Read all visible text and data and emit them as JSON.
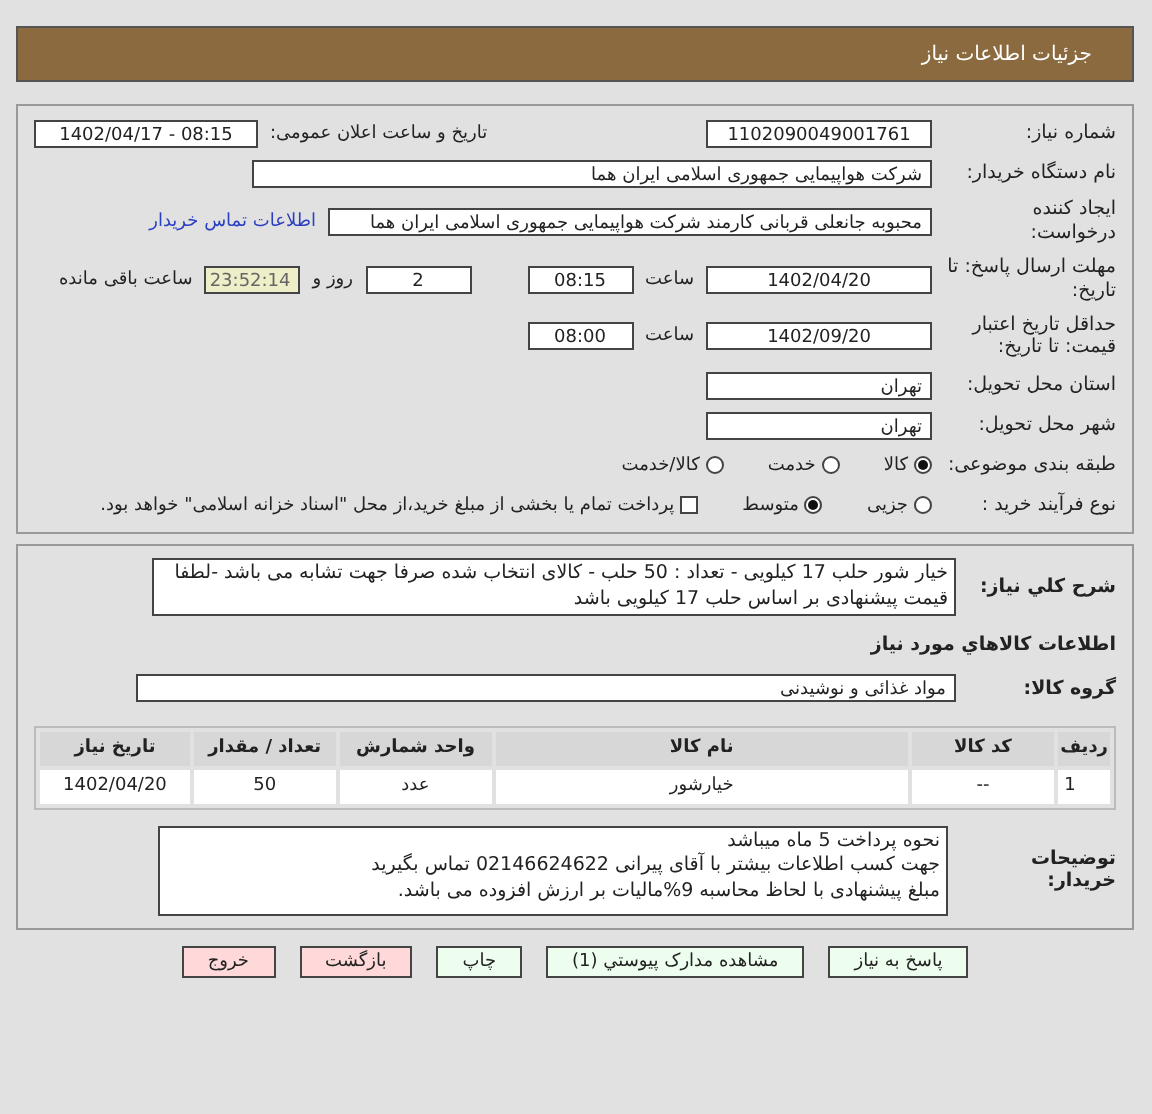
{
  "header": {
    "title": "جزئیات اطلاعات نیاز"
  },
  "need_number": {
    "label": "شماره نیاز:",
    "value": "1102090049001761"
  },
  "announce": {
    "label": "تاریخ و ساعت اعلان عمومی:",
    "value": "1402/04/17 - 08:15"
  },
  "buyer": {
    "label": "نام دستگاه خریدار:",
    "value": "شرکت هواپیمایی جمهوری اسلامی ایران هما"
  },
  "creator": {
    "label": "ایجاد کننده درخواست:",
    "value": "محبوبه جانعلی قربانی کارمند شرکت هواپیمایی جمهوری اسلامی ایران هما",
    "link": "اطلاعات تماس خریدار"
  },
  "deadline": {
    "label": "مهلت ارسال پاسخ: تا تاریخ:",
    "date": "1402/04/20",
    "time_label": "ساعت",
    "time": "08:15",
    "days": "2",
    "days_label": "روز و",
    "remaining": "23:52:14",
    "remaining_label": "ساعت باقی مانده"
  },
  "validity": {
    "label": "حداقل تاریخ اعتبار قیمت: تا تاریخ:",
    "date": "1402/09/20",
    "time_label": "ساعت",
    "time": "08:00"
  },
  "province": {
    "label": "استان محل تحویل:",
    "value": "تهران"
  },
  "city": {
    "label": "شهر محل تحویل:",
    "value": "تهران"
  },
  "category": {
    "label": "طبقه بندی موضوعی:",
    "options": [
      {
        "label": "کالا",
        "selected": true
      },
      {
        "label": "خدمت",
        "selected": false
      },
      {
        "label": "کالا/خدمت",
        "selected": false
      }
    ]
  },
  "process": {
    "label": "نوع فرآیند خرید :",
    "options": [
      {
        "label": "جزیی",
        "selected": false
      },
      {
        "label": "متوسط",
        "selected": true
      }
    ],
    "payment_checkbox": {
      "label": "پرداخت تمام یا بخشی از مبلغ خرید،از محل \"اسناد خزانه اسلامی\" خواهد بود.",
      "checked": false
    }
  },
  "description": {
    "label": "شرح کلي نياز:",
    "value": "خیار شور حلب 17 کیلویی - تعداد : 50 حلب - کالای انتخاب شده صرفا جهت تشابه می باشد -لطفا قیمت پیشنهادی بر اساس حلب 17 کیلویی باشد"
  },
  "goods_heading": "اطلاعات کالاهاي مورد نياز",
  "goods_group": {
    "label": "گروه کالا:",
    "value": "مواد غذائی و نوشیدنی"
  },
  "table": {
    "columns": [
      "ردیف",
      "کد کالا",
      "نام کالا",
      "واحد شمارش",
      "تعداد / مقدار",
      "تاریخ نیاز"
    ],
    "rows": [
      [
        "1",
        "--",
        "خیارشور",
        "عدد",
        "50",
        "1402/04/20"
      ]
    ]
  },
  "buyer_notes": {
    "label": "توضیحات خریدار:",
    "lines": [
      "نحوه پرداخت 5 ماه میباشد",
      "جهت کسب اطلاعات بیشتر با آقای پیرانی  02146624622 تماس بگیرید",
      "مبلغ پیشنهادی با لحاظ محاسبه 9%مالیات بر ارزش افزوده می باشد."
    ]
  },
  "buttons": [
    {
      "label": "پاسخ به نیاز",
      "color": "#eefeee"
    },
    {
      "label": "مشاهده مدارک پیوستي (1)",
      "color": "#eefeee"
    },
    {
      "label": "چاپ",
      "color": "#eefeee"
    },
    {
      "label": "بازگشت",
      "color": "#ffd9d9"
    },
    {
      "label": "خروج",
      "color": "#ffd9d9"
    }
  ]
}
